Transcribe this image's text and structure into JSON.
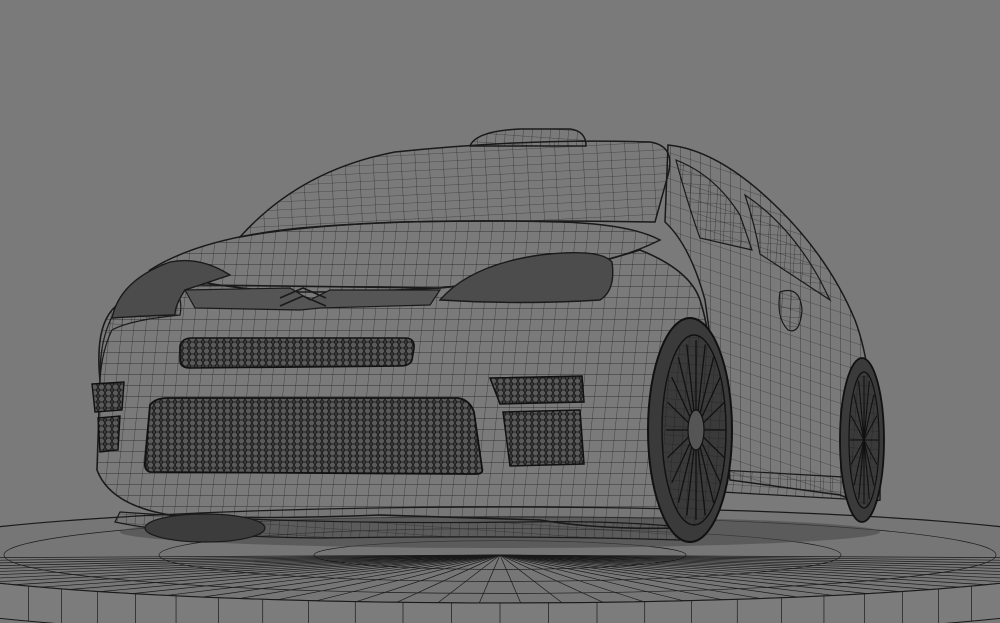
{
  "scene": {
    "background_color": "#7a7a7a",
    "wire_color": "#1a1a1a",
    "subject": "wireframe-car-model",
    "display_mode": "wireframe"
  }
}
